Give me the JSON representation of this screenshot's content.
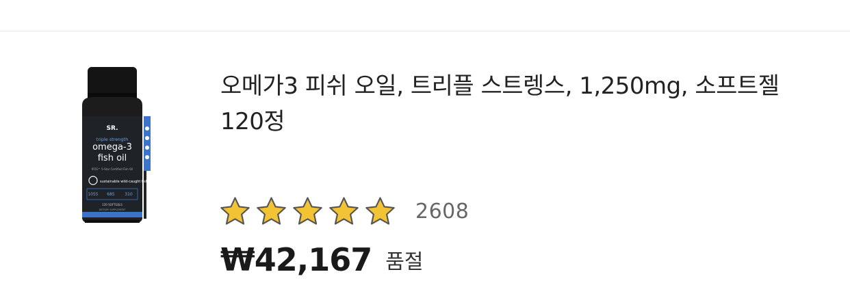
{
  "product": {
    "title": "오메가3 피쉬 오일, 트리플 스트렝스, 1,250mg, 소프트젤 120정",
    "image": {
      "icon_name": "fish-oil-bottle-image",
      "label": {
        "brand": "SR.",
        "line1": "triple strength",
        "line2": "omega-3",
        "line3": "fish oil",
        "certification": "IFOS™ 5-Star Certified Fish Oil",
        "sourced": "sustainable wild-caught fish",
        "stats": [
          "1055",
          "685",
          "310"
        ],
        "count": "120 SOFTGELS",
        "supplement": "DIETARY SUPPLEMENT"
      }
    },
    "rating": {
      "stars": 5,
      "review_count": "2608",
      "star_color": "#f2c335"
    },
    "price": "₩42,167",
    "stock_status": "품절"
  }
}
